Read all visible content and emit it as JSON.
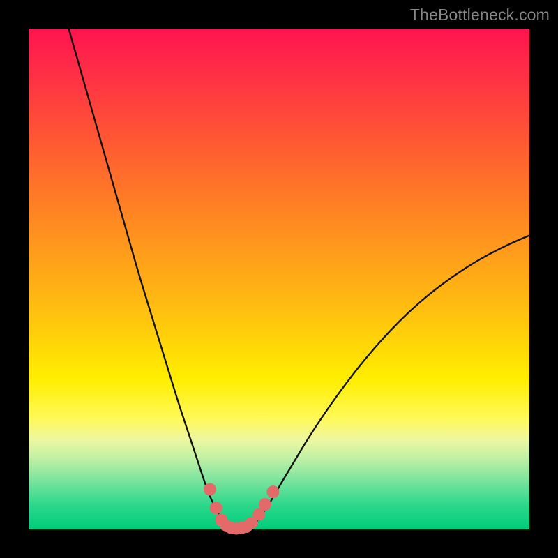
{
  "watermark": "TheBottleneck.com",
  "chart_data": {
    "type": "line",
    "title": "",
    "xlabel": "",
    "ylabel": "",
    "xlim": [
      0,
      100
    ],
    "ylim": [
      0,
      100
    ],
    "series": [
      {
        "name": "left-curve",
        "x": [
          8,
          10,
          12,
          14,
          16,
          18,
          20,
          22,
          24,
          26,
          28,
          30,
          32,
          33.5,
          34.8,
          36,
          37.2,
          38.2,
          39,
          39.6,
          40
        ],
        "y": [
          100,
          93,
          86,
          79,
          72,
          65,
          58,
          51,
          44.5,
          38,
          31.5,
          25,
          19,
          14.5,
          10.5,
          7,
          4.5,
          2.5,
          1.2,
          0.4,
          0
        ]
      },
      {
        "name": "right-curve",
        "x": [
          44,
          45,
          46.5,
          48,
          50,
          53,
          56,
          60,
          64,
          68,
          72,
          76,
          80,
          84,
          88,
          92,
          96,
          100
        ],
        "y": [
          0,
          1,
          2.8,
          5,
          8.5,
          13.5,
          18.5,
          24.5,
          30,
          35,
          39.5,
          43.5,
          47,
          50,
          52.7,
          55,
          57,
          58.7
        ]
      }
    ],
    "valley_points": {
      "name": "valley-dots",
      "points": [
        {
          "x": 36.2,
          "y": 8
        },
        {
          "x": 37.4,
          "y": 4.3
        },
        {
          "x": 38.5,
          "y": 1.9
        },
        {
          "x": 39.5,
          "y": 0.7
        },
        {
          "x": 40.5,
          "y": 0.3
        },
        {
          "x": 41.5,
          "y": 0.2
        },
        {
          "x": 42.5,
          "y": 0.3
        },
        {
          "x": 43.5,
          "y": 0.55
        },
        {
          "x": 44.5,
          "y": 1.3
        },
        {
          "x": 46.0,
          "y": 3.0
        },
        {
          "x": 47.2,
          "y": 5.0
        },
        {
          "x": 48.8,
          "y": 7.5
        }
      ]
    },
    "colors": {
      "curve": "#111111",
      "dots": "#e46a6a",
      "background_top": "#ff144e",
      "background_bottom": "#00cc7a",
      "frame": "#000000"
    }
  }
}
